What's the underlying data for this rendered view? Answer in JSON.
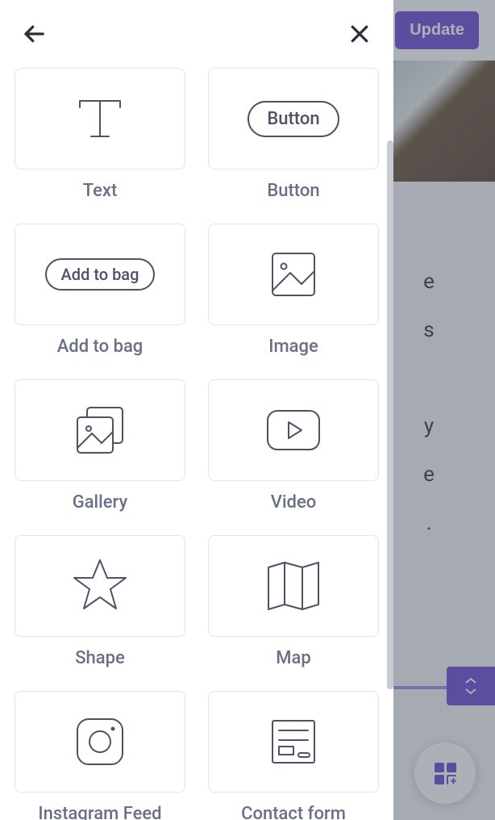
{
  "topbar": {
    "update": "Update"
  },
  "panel": {
    "items": [
      {
        "label": "Text"
      },
      {
        "label": "Button",
        "pill": "Button"
      },
      {
        "label": "Add to bag",
        "pill": "Add to bag"
      },
      {
        "label": "Image"
      },
      {
        "label": "Gallery"
      },
      {
        "label": "Video"
      },
      {
        "label": "Shape"
      },
      {
        "label": "Map"
      },
      {
        "label": "Instagram Feed"
      },
      {
        "label": "Contact form"
      }
    ]
  }
}
